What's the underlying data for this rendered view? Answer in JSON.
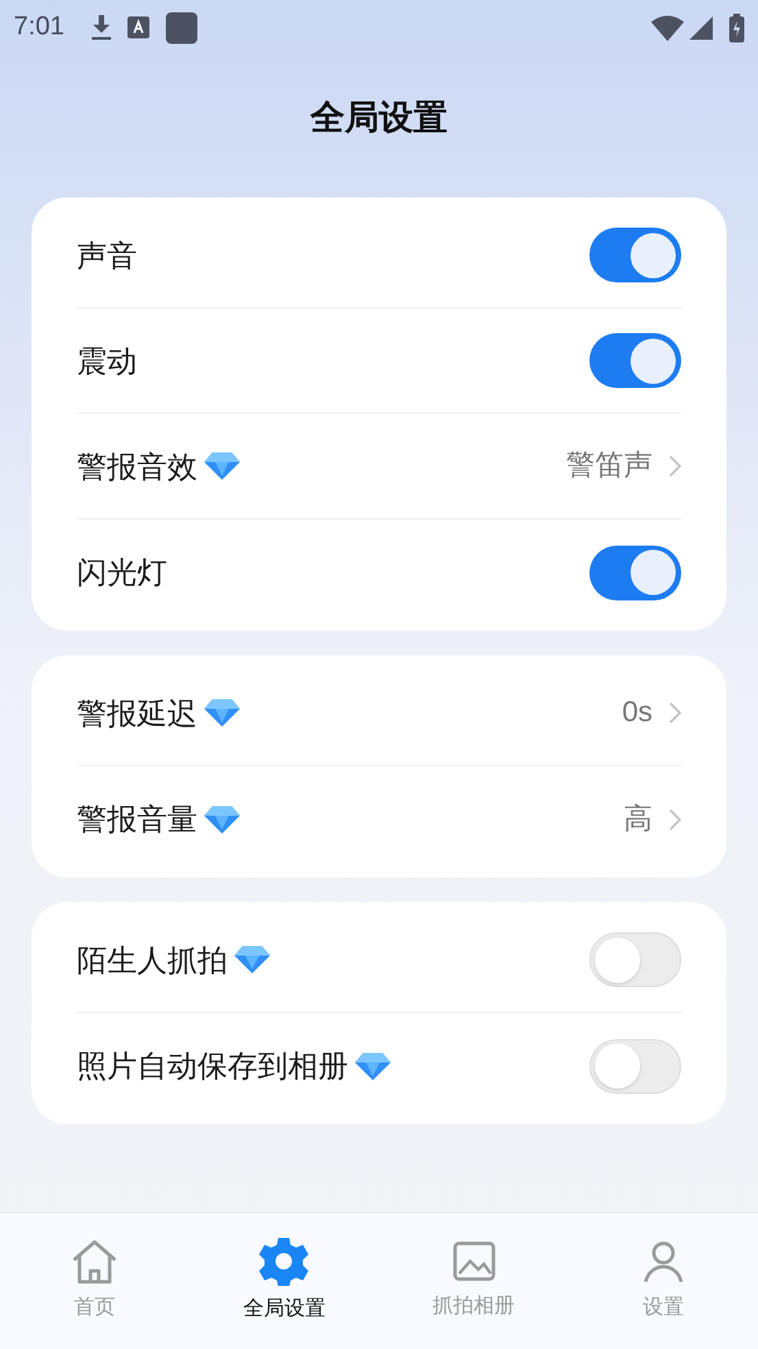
{
  "status_bar": {
    "time": "7:01"
  },
  "title": "全局设置",
  "groups": [
    {
      "rows": [
        {
          "kind": "toggle",
          "label": "声音",
          "premium": false,
          "on": true
        },
        {
          "kind": "toggle",
          "label": "震动",
          "premium": false,
          "on": true
        },
        {
          "kind": "link",
          "label": "警报音效",
          "premium": true,
          "value": "警笛声"
        },
        {
          "kind": "toggle",
          "label": "闪光灯",
          "premium": false,
          "on": true
        }
      ]
    },
    {
      "rows": [
        {
          "kind": "link",
          "label": "警报延迟",
          "premium": true,
          "value": "0s"
        },
        {
          "kind": "link",
          "label": "警报音量",
          "premium": true,
          "value": "高"
        }
      ]
    },
    {
      "rows": [
        {
          "kind": "toggle",
          "label": "陌生人抓拍",
          "premium": true,
          "on": false
        },
        {
          "kind": "toggle",
          "label": "照片自动保存到相册",
          "premium": true,
          "on": false
        }
      ]
    }
  ],
  "bottom_nav": [
    {
      "label": "首页",
      "selected": false
    },
    {
      "label": "全局设置",
      "selected": true
    },
    {
      "label": "抓拍相册",
      "selected": false
    },
    {
      "label": "设置",
      "selected": false
    }
  ]
}
